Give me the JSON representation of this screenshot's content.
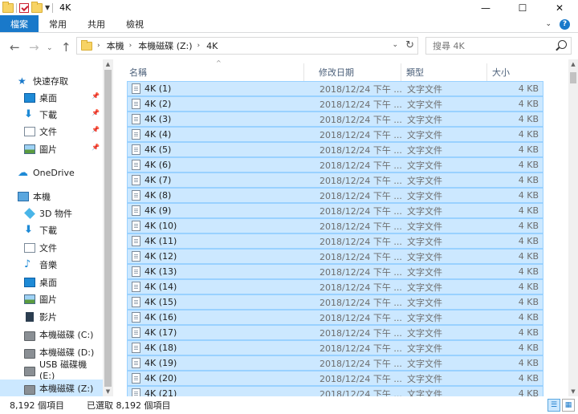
{
  "window": {
    "title": "4K",
    "buttons": {
      "minimize": "—",
      "maximize": "☐",
      "close": "✕"
    }
  },
  "ribbon": {
    "tabs": [
      "檔案",
      "常用",
      "共用",
      "檢視"
    ],
    "help": "?",
    "expand": "⌄"
  },
  "nav": {
    "back": "←",
    "forward": "→",
    "recent": "⌄",
    "up": "↑",
    "breadcrumb": [
      "本機",
      "本機磁碟 (Z:)",
      "4K"
    ],
    "crumb_sep": "›",
    "search_placeholder": "搜尋 4K"
  },
  "sidebar": {
    "items": [
      {
        "label": "快速存取",
        "icon": "star-icon",
        "pinned": false
      },
      {
        "label": "桌面",
        "icon": "desktop-icon",
        "pinned": true
      },
      {
        "label": "下載",
        "icon": "download-icon",
        "pinned": true
      },
      {
        "label": "文件",
        "icon": "document-icon",
        "pinned": true
      },
      {
        "label": "圖片",
        "icon": "pictures-icon",
        "pinned": true
      },
      {
        "label": "OneDrive",
        "icon": "cloud-icon",
        "pinned": false
      },
      {
        "label": "本機",
        "icon": "pc-icon",
        "pinned": false
      },
      {
        "label": "3D 物件",
        "icon": "3d-objects-icon",
        "pinned": false
      },
      {
        "label": "下載",
        "icon": "download-icon",
        "pinned": false
      },
      {
        "label": "文件",
        "icon": "document-icon",
        "pinned": false
      },
      {
        "label": "音樂",
        "icon": "music-icon",
        "pinned": false
      },
      {
        "label": "桌面",
        "icon": "desktop-icon",
        "pinned": false
      },
      {
        "label": "圖片",
        "icon": "pictures-icon",
        "pinned": false
      },
      {
        "label": "影片",
        "icon": "video-icon",
        "pinned": false
      },
      {
        "label": "本機磁碟 (C:)",
        "icon": "drive-icon",
        "pinned": false
      },
      {
        "label": "本機磁碟 (D:)",
        "icon": "drive-icon",
        "pinned": false
      },
      {
        "label": "USB 磁碟機 (E:)",
        "icon": "usb-drive-icon",
        "pinned": false
      },
      {
        "label": "本機磁碟 (Z:)",
        "icon": "drive-icon",
        "pinned": false,
        "selected": true
      }
    ]
  },
  "columns": {
    "name": "名稱",
    "modified": "修改日期",
    "type": "類型",
    "size": "大小"
  },
  "files": [
    {
      "name": "4K (1)",
      "modified": "2018/12/24 下午 ...",
      "type": "文字文件",
      "size": "4 KB"
    },
    {
      "name": "4K (2)",
      "modified": "2018/12/24 下午 ...",
      "type": "文字文件",
      "size": "4 KB"
    },
    {
      "name": "4K (3)",
      "modified": "2018/12/24 下午 ...",
      "type": "文字文件",
      "size": "4 KB"
    },
    {
      "name": "4K (4)",
      "modified": "2018/12/24 下午 ...",
      "type": "文字文件",
      "size": "4 KB"
    },
    {
      "name": "4K (5)",
      "modified": "2018/12/24 下午 ...",
      "type": "文字文件",
      "size": "4 KB"
    },
    {
      "name": "4K (6)",
      "modified": "2018/12/24 下午 ...",
      "type": "文字文件",
      "size": "4 KB"
    },
    {
      "name": "4K (7)",
      "modified": "2018/12/24 下午 ...",
      "type": "文字文件",
      "size": "4 KB"
    },
    {
      "name": "4K (8)",
      "modified": "2018/12/24 下午 ...",
      "type": "文字文件",
      "size": "4 KB"
    },
    {
      "name": "4K (9)",
      "modified": "2018/12/24 下午 ...",
      "type": "文字文件",
      "size": "4 KB"
    },
    {
      "name": "4K (10)",
      "modified": "2018/12/24 下午 ...",
      "type": "文字文件",
      "size": "4 KB"
    },
    {
      "name": "4K (11)",
      "modified": "2018/12/24 下午 ...",
      "type": "文字文件",
      "size": "4 KB"
    },
    {
      "name": "4K (12)",
      "modified": "2018/12/24 下午 ...",
      "type": "文字文件",
      "size": "4 KB"
    },
    {
      "name": "4K (13)",
      "modified": "2018/12/24 下午 ...",
      "type": "文字文件",
      "size": "4 KB"
    },
    {
      "name": "4K (14)",
      "modified": "2018/12/24 下午 ...",
      "type": "文字文件",
      "size": "4 KB"
    },
    {
      "name": "4K (15)",
      "modified": "2018/12/24 下午 ...",
      "type": "文字文件",
      "size": "4 KB"
    },
    {
      "name": "4K (16)",
      "modified": "2018/12/24 下午 ...",
      "type": "文字文件",
      "size": "4 KB"
    },
    {
      "name": "4K (17)",
      "modified": "2018/12/24 下午 ...",
      "type": "文字文件",
      "size": "4 KB"
    },
    {
      "name": "4K (18)",
      "modified": "2018/12/24 下午 ...",
      "type": "文字文件",
      "size": "4 KB"
    },
    {
      "name": "4K (19)",
      "modified": "2018/12/24 下午 ...",
      "type": "文字文件",
      "size": "4 KB"
    },
    {
      "name": "4K (20)",
      "modified": "2018/12/24 下午 ...",
      "type": "文字文件",
      "size": "4 KB"
    },
    {
      "name": "4K (21)",
      "modified": "2018/12/24 下午 ...",
      "type": "文字文件",
      "size": "4 KB"
    }
  ],
  "status": {
    "count": "8,192 個項目",
    "selected": "已選取 8,192 個項目"
  },
  "colors": {
    "accent": "#1979ca",
    "selection_fill": "#cce8ff",
    "selection_border": "#99d1ff"
  }
}
